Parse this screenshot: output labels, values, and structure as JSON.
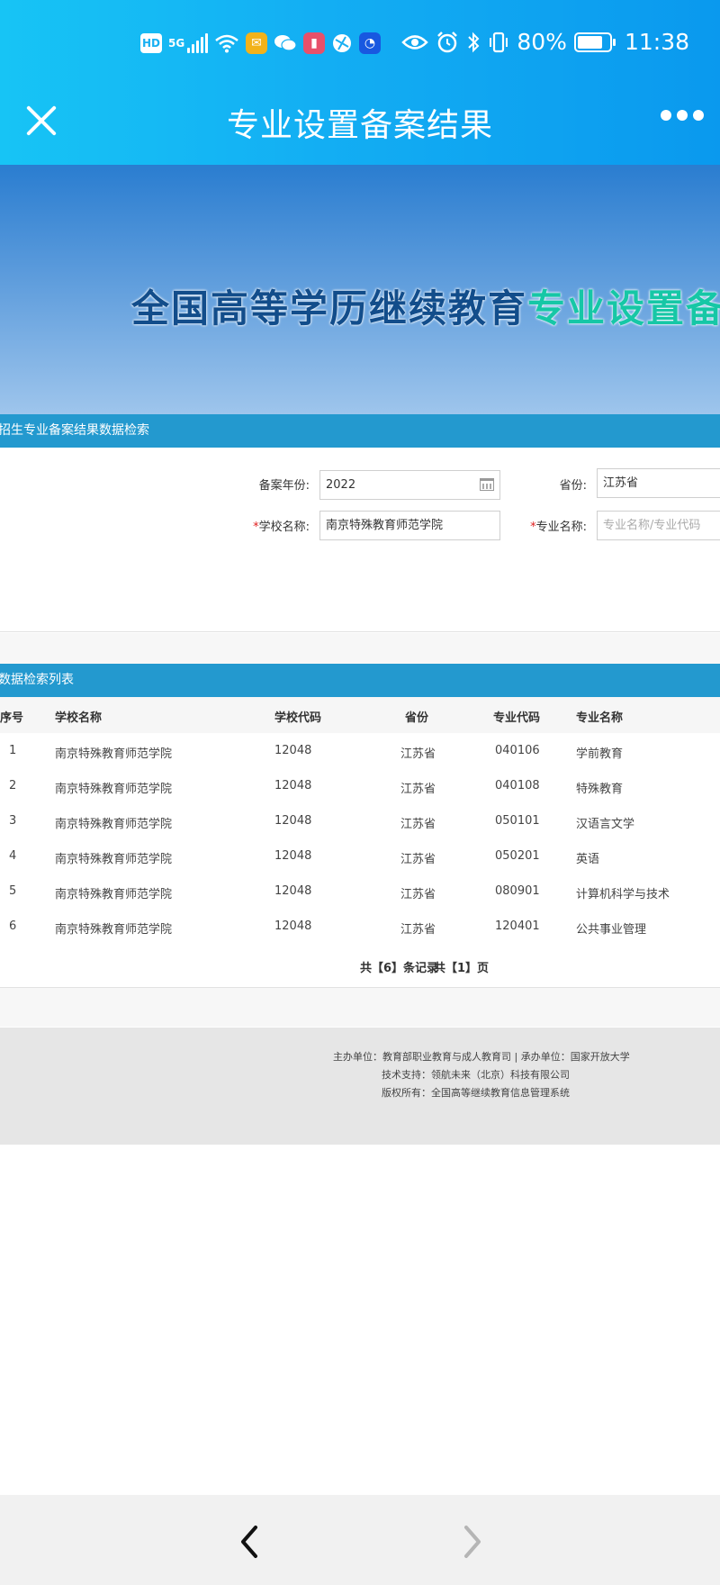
{
  "status_bar": {
    "hd": "HD",
    "network": "5G",
    "battery": "80%",
    "battery_level": 0.8,
    "time": "11:38"
  },
  "header": {
    "title": "专业设置备案结果"
  },
  "banner": {
    "title_part1": "全国高等学历继续教育",
    "title_part2": "专业设置备案"
  },
  "search": {
    "section_title": "招生专业备案结果数据检索",
    "year_label": "备案年份:",
    "year_value": "2022",
    "province_label": "省份:",
    "province_value": "江苏省",
    "school_label": "学校名称:",
    "school_value": "南京特殊教育师范学院",
    "major_label": "专业名称:",
    "major_placeholder": "专业名称/专业代码",
    "required_mark": "*"
  },
  "results": {
    "section_title": "数据检索列表",
    "columns": [
      "序号",
      "学校名称",
      "学校代码",
      "省份",
      "专业代码",
      "专业名称"
    ],
    "rows": [
      [
        "1",
        "南京特殊教育师范学院",
        "12048",
        "江苏省",
        "040106",
        "学前教育"
      ],
      [
        "2",
        "南京特殊教育师范学院",
        "12048",
        "江苏省",
        "040108",
        "特殊教育"
      ],
      [
        "3",
        "南京特殊教育师范学院",
        "12048",
        "江苏省",
        "050101",
        "汉语言文学"
      ],
      [
        "4",
        "南京特殊教育师范学院",
        "12048",
        "江苏省",
        "050201",
        "英语"
      ],
      [
        "5",
        "南京特殊教育师范学院",
        "12048",
        "江苏省",
        "080901",
        "计算机科学与技术"
      ],
      [
        "6",
        "南京特殊教育师范学院",
        "12048",
        "江苏省",
        "120401",
        "公共事业管理"
      ]
    ],
    "pager_records": "共【6】条记录",
    "pager_pages": "共【1】页"
  },
  "footer": {
    "line1": "主办单位：教育部职业教育与成人教育司 | 承办单位：国家开放大学",
    "line2": "技术支持：领航未来（北京）科技有限公司",
    "line3": "版权所有：全国高等继续教育信息管理系统"
  },
  "colors": {
    "header_blue": "#13aef3",
    "section_blue": "#2399cf",
    "banner_title_dark": "#124d8b",
    "banner_title_teal": "#16c7a6"
  },
  "icons": {
    "close": "close-icon",
    "more": "more-dots-icon",
    "back": "chevron-left-icon",
    "forward": "chevron-right-icon",
    "calendar": "calendar-icon"
  }
}
